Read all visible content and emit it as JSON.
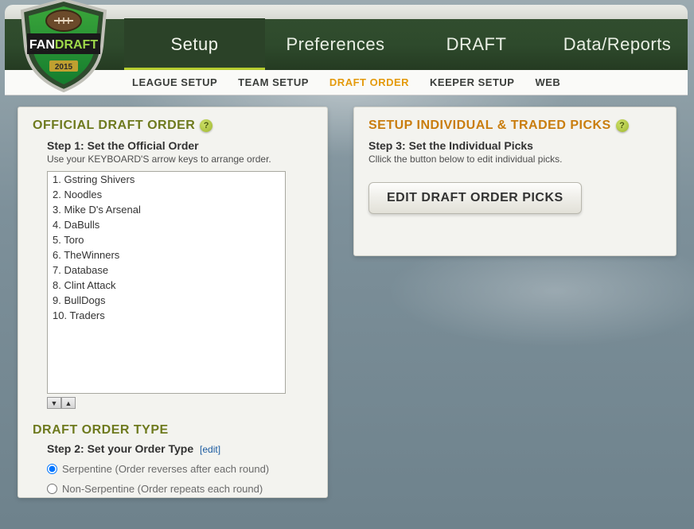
{
  "logo": {
    "brand_top": "FAN",
    "brand_bottom": "DRAFT",
    "year": "2015"
  },
  "nav": {
    "tabs": [
      {
        "label": "Setup",
        "active": true
      },
      {
        "label": "Preferences",
        "active": false
      },
      {
        "label": "DRAFT",
        "active": false
      },
      {
        "label": "Data/Reports",
        "active": false
      }
    ],
    "sub": [
      {
        "label": "LEAGUE SETUP",
        "active": false
      },
      {
        "label": "TEAM SETUP",
        "active": false
      },
      {
        "label": "DRAFT ORDER",
        "active": true
      },
      {
        "label": "KEEPER SETUP",
        "active": false
      },
      {
        "label": "WEB",
        "active": false
      }
    ]
  },
  "left": {
    "title": "OFFICIAL DRAFT ORDER",
    "step1_title": "Step 1: Set the Official Order",
    "step1_sub": "Use your KEYBOARD'S arrow keys to arrange order.",
    "teams": [
      "1. Gstring Shivers",
      "2. Noodles",
      "3. Mike D's Arsenal",
      "4. DaBulls",
      "5. Toro",
      "6. TheWinners",
      "7. Database",
      "8. Clint Attack",
      "9. BullDogs",
      "10. Traders"
    ],
    "section2_title": "DRAFT ORDER TYPE",
    "step2_title": "Step 2: Set your Order Type",
    "edit_label": "[edit]",
    "radio1": "Serpentine (Order reverses after each round)",
    "radio2": "Non-Serpentine (Order repeats each round)"
  },
  "right": {
    "title": "SETUP INDIVIDUAL & TRADED PICKS",
    "step3_title": "Step 3: Set the Individual Picks",
    "step3_sub": "Cllick the button below to edit individual picks.",
    "button": "EDIT DRAFT ORDER PICKS"
  },
  "help_glyph": "?"
}
